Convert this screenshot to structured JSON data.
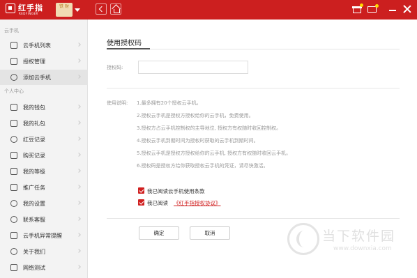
{
  "app": {
    "brand_name": "红手指",
    "brand_sub": "REDFINGER",
    "user_badge": "铁 财"
  },
  "sidebar": {
    "section_cloud": "云手机",
    "section_personal": "个人中心",
    "items": [
      {
        "label": "云手机列表",
        "icon": "phone-icon"
      },
      {
        "label": "授权管理",
        "icon": "shield-icon"
      },
      {
        "label": "添加云手机",
        "icon": "plus-circle-icon"
      },
      {
        "label": "我的钱包",
        "icon": "wallet-icon"
      },
      {
        "label": "我的礼包",
        "icon": "gift-icon"
      },
      {
        "label": "红豆记录",
        "icon": "bean-icon"
      },
      {
        "label": "购买记录",
        "icon": "receipt-icon"
      },
      {
        "label": "我的等级",
        "icon": "crown-icon"
      },
      {
        "label": "推广任务",
        "icon": "flag-icon"
      },
      {
        "label": "我的设置",
        "icon": "gear-icon"
      },
      {
        "label": "联系客服",
        "icon": "headset-icon"
      },
      {
        "label": "云手机异常提醒",
        "icon": "bell-icon"
      },
      {
        "label": "关于我们",
        "icon": "smile-icon"
      },
      {
        "label": "网络测试",
        "icon": "network-icon"
      }
    ]
  },
  "main": {
    "title": "使用授权码",
    "code_label": "授权码:",
    "code_value": "",
    "notes_label": "使用说明:",
    "notes": [
      "1.最多拥有20个授权云手机。",
      "2.授权云手机是授权方授权给你的云手机，免费使用。",
      "3.授权方占云手机控制权的主导地位, 授权方有权随时收回控制权。",
      "4.授权云手机到期时间为授权时获取的云手机到期时间。",
      "5.授权云手机是授权方授权给你的云手机, 授权方有权随时收回云手机。",
      "6.授权码是授权方给你获取授权云手机的凭证，请尽快激活。"
    ],
    "agree_terms_label": "我已阅读云手机使用条款",
    "agree_protocol_prefix": "我已阅读",
    "agree_protocol_link": "《红手指授权协议》",
    "confirm_label": "确定",
    "cancel_label": "取消"
  },
  "watermark": {
    "text": "当下软件园",
    "url": "www.downxia.com"
  }
}
